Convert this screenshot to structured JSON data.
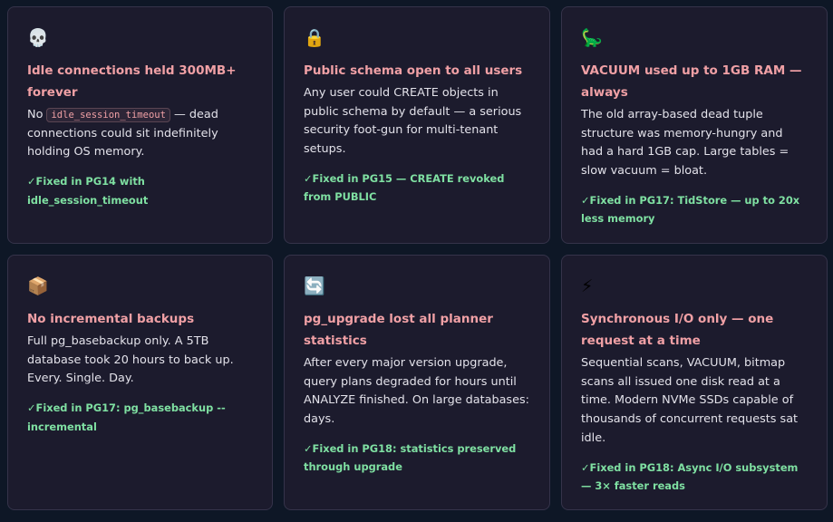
{
  "cards": [
    {
      "icon": "💀",
      "icon_name": "skull-icon",
      "title": "Idle connections held 300MB+ forever",
      "desc_before": "No ",
      "desc_code": "idle_session_timeout",
      "desc_after": " — dead connections could sit indefinitely holding OS memory.",
      "fix": "✓Fixed in PG14 with idle_session_timeout"
    },
    {
      "icon": "🔒",
      "icon_name": "lock-icon",
      "title": "Public schema open to all users",
      "desc": "Any user could CREATE objects in public schema by default — a serious security foot-gun for multi-tenant setups.",
      "fix": "✓Fixed in PG15 — CREATE revoked from PUBLIC"
    },
    {
      "icon": "🦕",
      "icon_name": "dinosaur-icon",
      "title": "VACUUM used up to 1GB RAM — always",
      "desc": "The old array-based dead tuple structure was memory-hungry and had a hard 1GB cap. Large tables = slow vacuum = bloat.",
      "fix": "✓Fixed in PG17: TidStore — up to 20x less memory"
    },
    {
      "icon": "📦",
      "icon_name": "package-icon",
      "title": "No incremental backups",
      "desc": "Full pg_basebackup only. A 5TB database took 20 hours to back up. Every. Single. Day.",
      "fix": "✓Fixed in PG17: pg_basebackup --incremental"
    },
    {
      "icon": "🔄",
      "icon_name": "refresh-icon",
      "title": "pg_upgrade lost all planner statistics",
      "desc": "After every major version upgrade, query plans degraded for hours until ANALYZE finished. On large databases: days.",
      "fix": "✓Fixed in PG18: statistics preserved through upgrade"
    },
    {
      "icon": "⚡",
      "icon_name": "lightning-icon",
      "title": "Synchronous I/O only — one request at a time",
      "desc": "Sequential scans, VACUUM, bitmap scans all issued one disk read at a time. Modern NVMe SSDs capable of thousands of concurrent requests sat idle.",
      "fix": "✓Fixed in PG18: Async I/O subsystem — 3× faster reads"
    }
  ]
}
